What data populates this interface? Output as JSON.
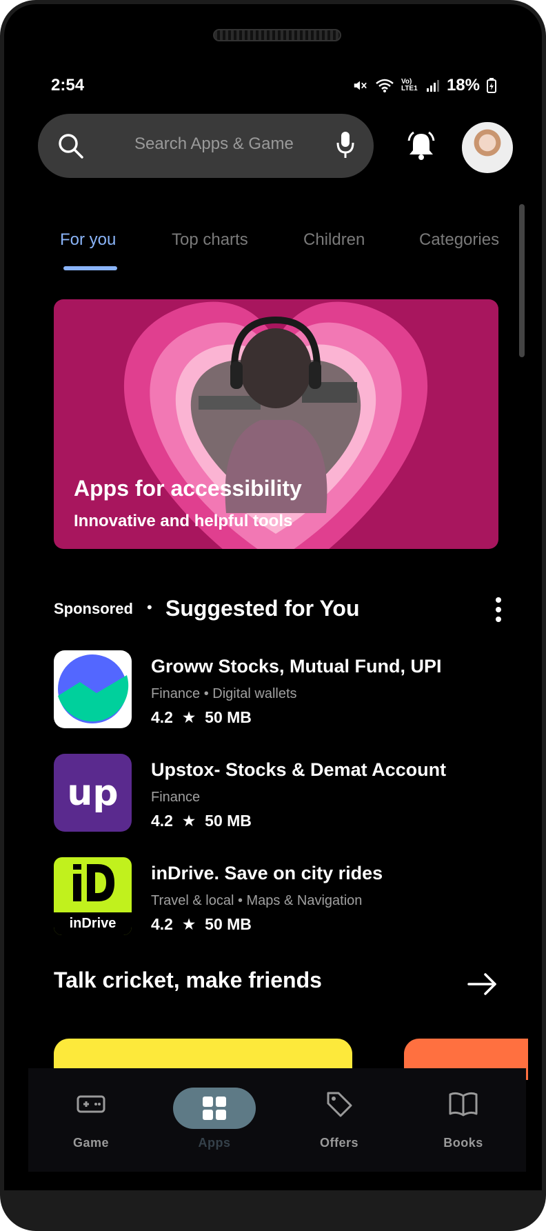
{
  "status_bar": {
    "time": "2:54",
    "network_label": "Vo) LTE1",
    "battery_percent": "18%"
  },
  "search": {
    "placeholder": "Search Apps & Game"
  },
  "tabs": [
    {
      "label": "For you",
      "active": true
    },
    {
      "label": "Top charts",
      "active": false
    },
    {
      "label": "Children",
      "active": false
    },
    {
      "label": "Categories",
      "active": false
    }
  ],
  "banner": {
    "title": "Apps for accessibility",
    "subtitle": "Innovative and helpful tools"
  },
  "suggested": {
    "sponsored_label": "Sponsored",
    "separator": "•",
    "title": "Suggested for You",
    "apps": [
      {
        "name": "Groww Stocks, Mutual Fund, UPI",
        "category": "Finance • Digital wallets",
        "rating": "4.2",
        "star": "★",
        "size": "50 MB"
      },
      {
        "name": "Upstox- Stocks & Demat Account",
        "category": "Finance",
        "rating": "4.2",
        "star": "★",
        "size": "50 MB"
      },
      {
        "name": "inDrive. Save on city rides",
        "category": "Travel & local • Maps & Navigation",
        "rating": "4.2",
        "star": "★",
        "size": "50 MB"
      }
    ]
  },
  "cricket_section": {
    "title": "Talk cricket, make friends"
  },
  "bottom_nav": [
    {
      "label": "Game",
      "icon": "gamepad-icon",
      "active": false
    },
    {
      "label": "Apps",
      "icon": "apps-grid-icon",
      "active": true
    },
    {
      "label": "Offers",
      "icon": "tag-icon",
      "active": false
    },
    {
      "label": "Books",
      "icon": "book-icon",
      "active": false
    }
  ],
  "logos": {
    "upstox": "up",
    "indrive": "inDrive"
  },
  "colors": {
    "accent": "#8ab4f8",
    "banner_bg": "#a8165e",
    "active_nav_pill": "#5e7a86"
  }
}
